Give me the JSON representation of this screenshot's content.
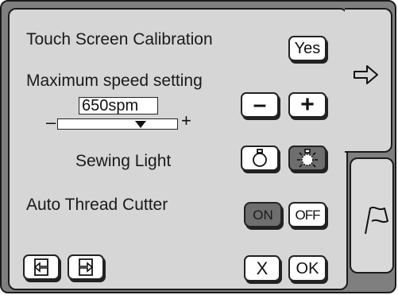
{
  "settings": {
    "calibration_label": "Touch Screen Calibration",
    "calibration_button": "Yes",
    "max_speed_label": "Maximum speed setting",
    "speed_value": "650spm",
    "speed_slider_level": 0.69,
    "minus_sign": "–",
    "plus_sign": "+",
    "decrease_button": "–",
    "increase_button": "+",
    "sewing_light_label": "Sewing Light",
    "auto_thread_label": "Auto Thread Cutter",
    "thread_on": "ON",
    "thread_off": "OFF",
    "thread_state": "ON"
  },
  "footer": {
    "cancel_label": "X",
    "ok_label": "OK"
  },
  "icons": {
    "next_tab": "arrow-right-icon",
    "flag_tab": "flag-icon",
    "page_prev": "page-back-icon",
    "page_next": "page-forward-icon",
    "light_off": "bulb-off-icon",
    "light_on": "bulb-on-icon"
  }
}
